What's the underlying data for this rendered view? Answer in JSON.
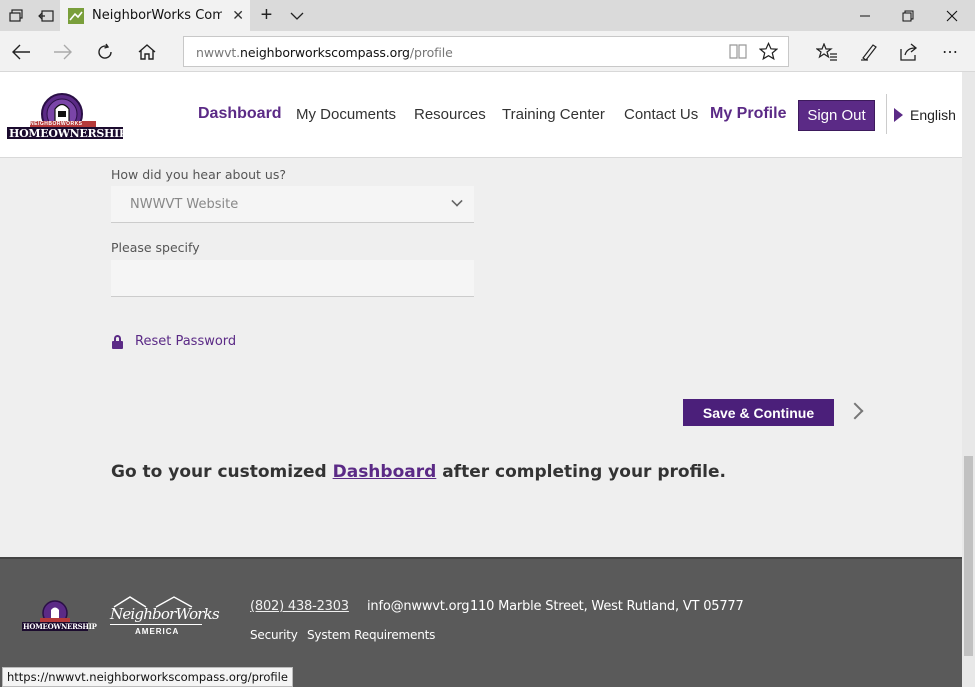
{
  "browser": {
    "tab_title": "NeighborWorks Compa",
    "url_prefix": "nwwvt.",
    "url_host": "neighborworkscompass.org",
    "url_path": "/profile",
    "status_url": "https://nwwvt.neighborworkscompass.org/profile"
  },
  "header": {
    "logo_text": "HOMEOWNERSHIP",
    "logo_subtext": "NEIGHBORWORKS",
    "nav": {
      "dashboard": "Dashboard",
      "documents": "My Documents",
      "resources": "Resources",
      "training": "Training Center",
      "contact": "Contact Us",
      "profile": "My Profile"
    },
    "sign_out": "Sign Out",
    "language": "English"
  },
  "form": {
    "hear_label": "How did you hear about us?",
    "hear_value": "NWWVT Website",
    "specify_label": "Please specify",
    "specify_value": "",
    "reset_password": "Reset Password",
    "save_button": "Save & Continue"
  },
  "goto": {
    "before": "Go to your customized ",
    "link": "Dashboard",
    "after": " after completing your profile."
  },
  "footer": {
    "logo_text": "HOMEOWNERSHIP",
    "nw_logo_text": "NeighborWorks",
    "nw_logo_sub": "AMERICA",
    "phone": "(802) 438-2303",
    "email": "info@nwwvt.org",
    "address": "110 Marble Street, West Rutland, VT 05777",
    "security": "Security",
    "requirements": "System Requirements"
  },
  "colors": {
    "brand_purple": "#5b2a86",
    "footer_bg": "#5a5a5a"
  }
}
